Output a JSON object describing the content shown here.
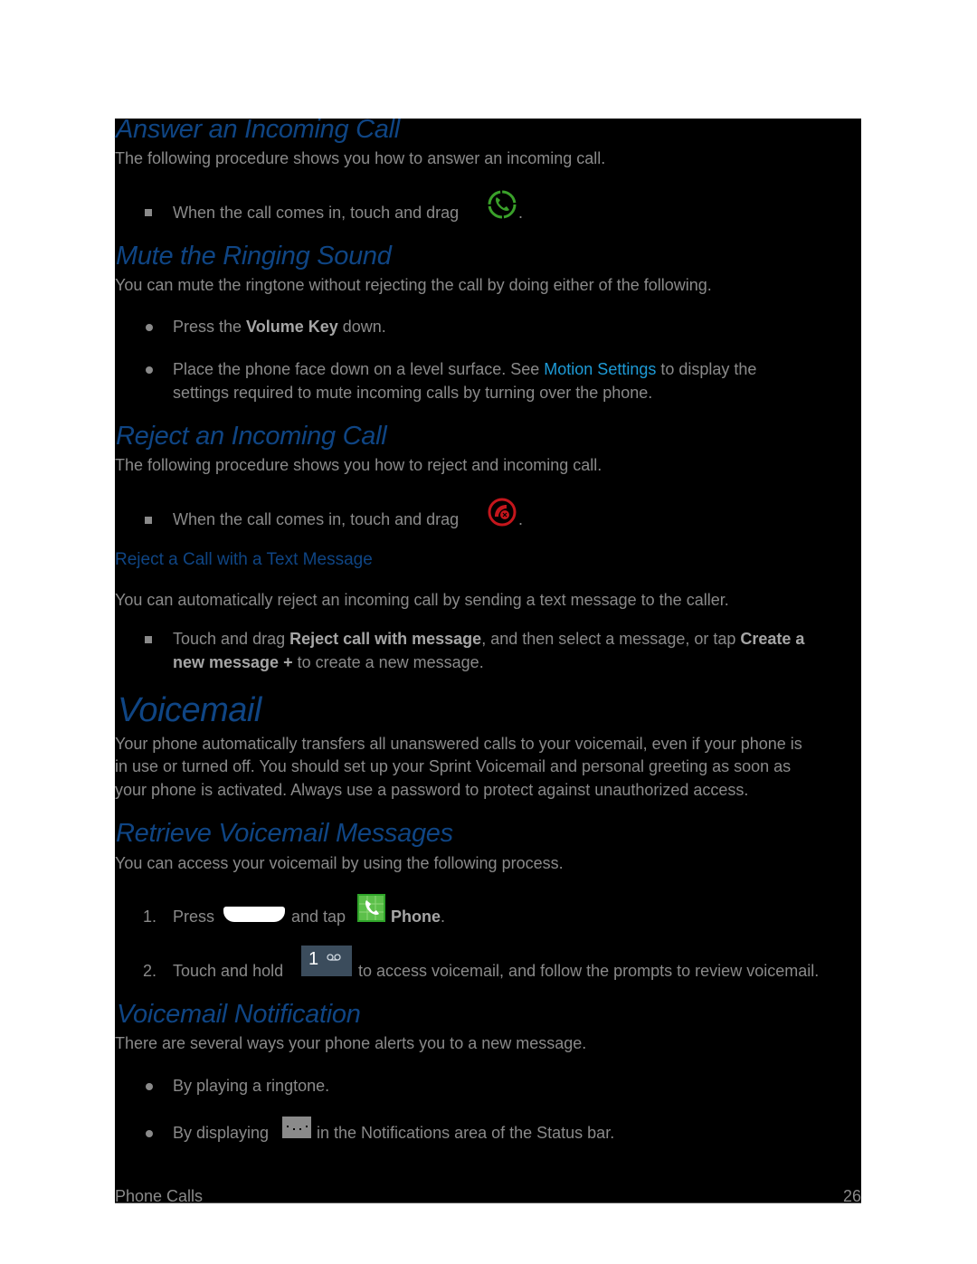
{
  "sections": {
    "answer": {
      "heading": "Answer an Incoming Call",
      "intro": "The following procedure shows you how to answer an incoming call.",
      "step_text": "When the call comes in, touch and drag",
      "step_suffix": ".",
      "icon": "answer-call-icon",
      "icon_color": "#3aa02a"
    },
    "mute": {
      "heading": "Mute the Ringing Sound",
      "intro": "You can mute the ringtone without rejecting the call by doing either of the following.",
      "item1_pre": "Press the ",
      "item1_bold": "Volume Key",
      "item1_post": " down.",
      "item2_pre": "Place the phone face down on a level surface. See ",
      "item2_link": "Motion Settings",
      "item2_post": " to display the",
      "item2_line2": "settings required to mute incoming calls by turning over the phone."
    },
    "reject": {
      "heading": "Reject an Incoming Call",
      "intro": "The following procedure shows you how to reject and incoming call.",
      "step_text": "When the call comes in, touch and drag",
      "step_suffix": ".",
      "icon": "reject-call-icon",
      "icon_color": "#c4161c"
    },
    "reject_text": {
      "heading": "Reject a Call with a Text Message",
      "intro": "You can automatically reject an incoming call by sending a text message to the caller.",
      "step_pre": "Touch and drag ",
      "step_bold1": "Reject call with message",
      "step_mid": ", and then select a message, or tap ",
      "step_bold2": "Create a",
      "step_bold3": "new message +",
      "step_post": " to create a new message."
    },
    "voicemail": {
      "heading": "Voicemail",
      "line1": "Your phone automatically transfers all unanswered calls to your voicemail, even if your phone is",
      "line2": "in use or turned off. You should set up your Sprint Voicemail and personal greeting as soon as",
      "line3": "your phone is activated. Always use a password to protect against unauthorized access."
    },
    "retrieve": {
      "heading": "Retrieve Voicemail Messages",
      "intro": "You can access your voicemail by using the following process.",
      "step1_num": "1.",
      "step1_pre": "Press",
      "step1_mid": "and tap",
      "step1_bold": "Phone",
      "step1_post": ".",
      "step2_num": "2.",
      "step2_pre": "Touch and hold",
      "step2_key_label": "1",
      "step2_post": "to access voicemail, and follow the prompts to review voicemail."
    },
    "notification": {
      "heading": "Voicemail Notification",
      "intro": "There are several ways your phone alerts you to a new message.",
      "item1": "By playing a ringtone.",
      "item2_pre": "By displaying",
      "item2_post": "in the Notifications area of the Status bar."
    }
  },
  "footer": {
    "chapter": "Phone Calls",
    "page_number": "26"
  }
}
